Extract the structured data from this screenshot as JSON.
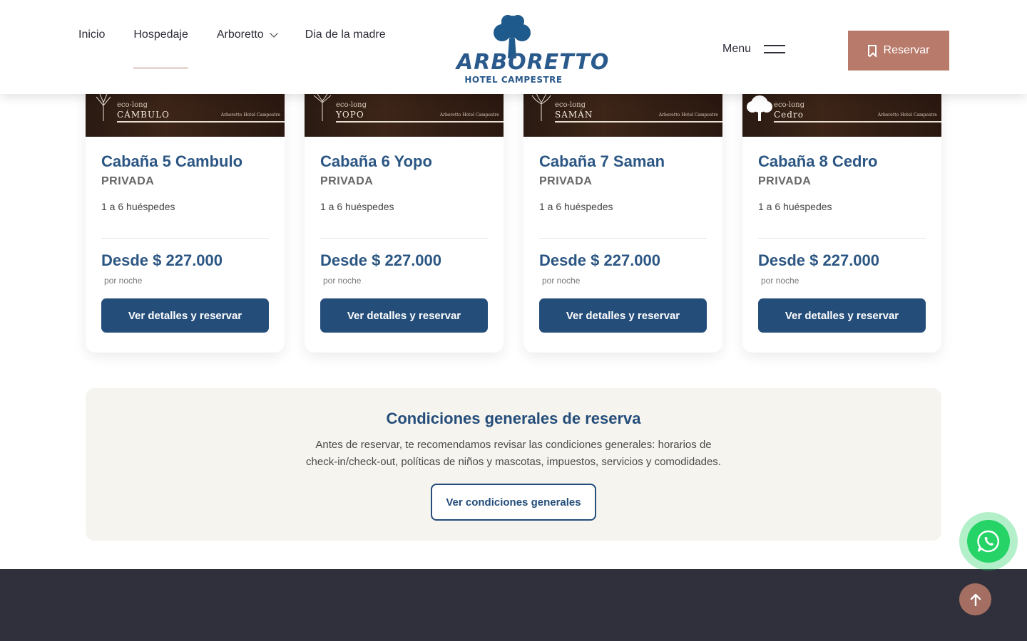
{
  "header": {
    "nav": [
      {
        "label": "Inicio"
      },
      {
        "label": "Hospedaje",
        "active": true
      },
      {
        "label": "Arboretto",
        "has_dropdown": true
      },
      {
        "label": "Dia de la madre"
      }
    ],
    "logo": {
      "title": "ARBORETTO",
      "subtitle": "HOTEL CAMPESTRE"
    },
    "menu_label": "Menu",
    "reserve_label": "Reservar"
  },
  "cards": [
    {
      "image_eco": "eco-long",
      "image_name": "CÁMBULO",
      "image_brand": "Arboretto Hotel Campestre",
      "title": "Cabaña 5 Cambulo",
      "type": "PRIVADA",
      "guests": "1 a 6 huéspedes",
      "price": "Desde $ 227.000",
      "per": "por noche",
      "button": "Ver detalles y reservar"
    },
    {
      "image_eco": "eco-long",
      "image_name": "YOPO",
      "image_brand": "Arboretto Hotel Campestre",
      "title": "Cabaña 6 Yopo",
      "type": "PRIVADA",
      "guests": "1 a 6 huéspedes",
      "price": "Desde $ 227.000",
      "per": "por noche",
      "button": "Ver detalles y reservar"
    },
    {
      "image_eco": "eco-long",
      "image_name": "SAMÁN",
      "image_brand": "Arboretto Hotel Campestre",
      "title": "Cabaña 7 Saman",
      "type": "PRIVADA",
      "guests": "1 a 6 huéspedes",
      "price": "Desde $ 227.000",
      "per": "por noche",
      "button": "Ver detalles y reservar"
    },
    {
      "image_eco": "eco-long",
      "image_name": "Cedro",
      "image_brand": "Arboretto Hotel Campestre",
      "title": "Cabaña 8 Cedro",
      "type": "PRIVADA",
      "guests": "1 a 6 huéspedes",
      "price": "Desde $ 227.000",
      "per": "por noche",
      "button": "Ver detalles y reservar"
    }
  ],
  "conditions": {
    "title": "Condiciones generales de reserva",
    "text": "Antes de reservar, te recomendamos revisar las condiciones generales: horarios de check-in/check-out, políticas de niños y mascotas, impuestos, servicios y comodidades.",
    "button": "Ver condiciones generales"
  },
  "floating": {
    "whatsapp_icon": "whatsapp-icon",
    "scroll_top_icon": "arrow-up-icon"
  },
  "colors": {
    "brand_blue": "#244d7a",
    "accent": "#b87a6a",
    "whatsapp": "#25d366",
    "footer": "#302f3c"
  }
}
